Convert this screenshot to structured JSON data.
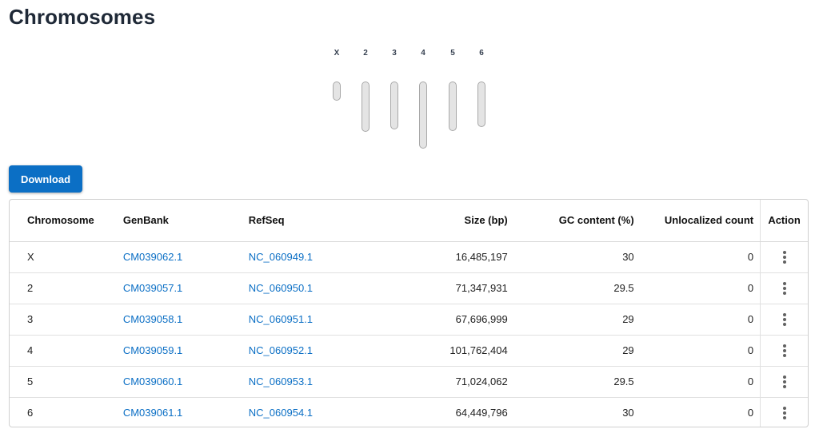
{
  "page": {
    "title": "Chromosomes"
  },
  "ideogram": {
    "bar_fill": "#e4e4e4",
    "bar_border": "#a8a8a8",
    "labels": [
      "X",
      "2",
      "3",
      "4",
      "5",
      "6"
    ]
  },
  "toolbar": {
    "download_label": "Download",
    "accent": "#0b6fc5"
  },
  "table": {
    "headers": {
      "chromosome": "Chromosome",
      "genbank": "GenBank",
      "refseq": "RefSeq",
      "size": "Size (bp)",
      "gc": "GC content (%)",
      "unlocalized": "Unlocalized count",
      "action": "Action"
    },
    "rows": [
      {
        "chromosome": "X",
        "genbank": "CM039062.1",
        "refseq": "NC_060949.1",
        "size": "16,485,197",
        "gc": "30",
        "unlocalized": "0",
        "action_icon": "more-vertical-icon"
      },
      {
        "chromosome": "2",
        "genbank": "CM039057.1",
        "refseq": "NC_060950.1",
        "size": "71,347,931",
        "gc": "29.5",
        "unlocalized": "0",
        "action_icon": "more-vertical-icon"
      },
      {
        "chromosome": "3",
        "genbank": "CM039058.1",
        "refseq": "NC_060951.1",
        "size": "67,696,999",
        "gc": "29",
        "unlocalized": "0",
        "action_icon": "more-vertical-icon"
      },
      {
        "chromosome": "4",
        "genbank": "CM039059.1",
        "refseq": "NC_060952.1",
        "size": "101,762,404",
        "gc": "29",
        "unlocalized": "0",
        "action_icon": "more-vertical-icon"
      },
      {
        "chromosome": "5",
        "genbank": "CM039060.1",
        "refseq": "NC_060953.1",
        "size": "71,024,062",
        "gc": "29.5",
        "unlocalized": "0",
        "action_icon": "more-vertical-icon"
      },
      {
        "chromosome": "6",
        "genbank": "CM039061.1",
        "refseq": "NC_060954.1",
        "size": "64,449,796",
        "gc": "30",
        "unlocalized": "0",
        "action_icon": "more-vertical-icon"
      }
    ]
  }
}
